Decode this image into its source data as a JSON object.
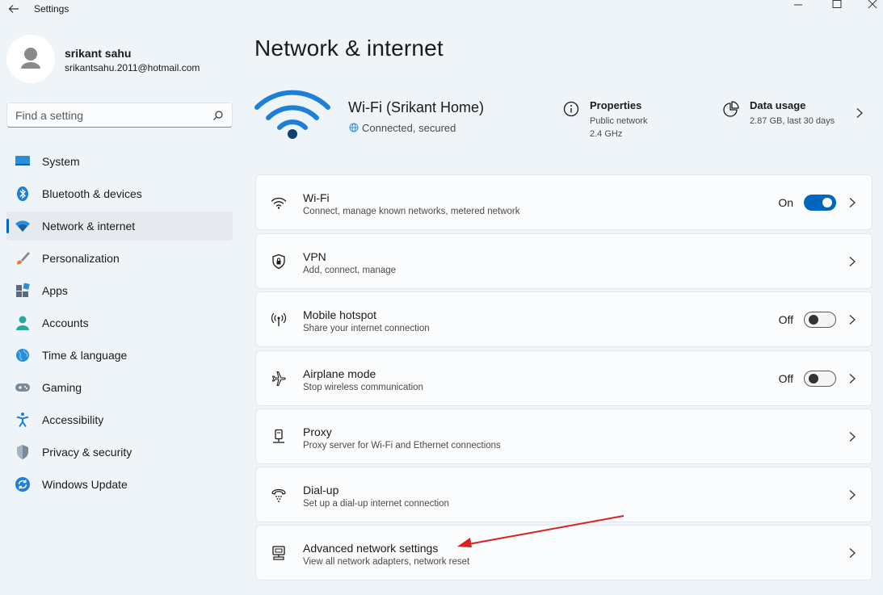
{
  "window": {
    "title": "Settings"
  },
  "user": {
    "name": "srikant sahu",
    "email": "srikantsahu.2011@hotmail.com"
  },
  "search": {
    "placeholder": "Find a setting"
  },
  "sidebar": {
    "items": [
      {
        "label": "System",
        "icon": "system-icon"
      },
      {
        "label": "Bluetooth & devices",
        "icon": "bluetooth-icon"
      },
      {
        "label": "Network & internet",
        "icon": "network-icon",
        "selected": true
      },
      {
        "label": "Personalization",
        "icon": "brush-icon"
      },
      {
        "label": "Apps",
        "icon": "apps-icon"
      },
      {
        "label": "Accounts",
        "icon": "account-icon"
      },
      {
        "label": "Time & language",
        "icon": "globe-icon"
      },
      {
        "label": "Gaming",
        "icon": "gamepad-icon"
      },
      {
        "label": "Accessibility",
        "icon": "accessibility-icon"
      },
      {
        "label": "Privacy & security",
        "icon": "shield-icon"
      },
      {
        "label": "Windows Update",
        "icon": "update-icon"
      }
    ]
  },
  "page": {
    "title": "Network & internet"
  },
  "hero": {
    "network_name": "Wi-Fi (Srikant Home)",
    "status": "Connected, secured",
    "properties": {
      "title": "Properties",
      "line1": "Public network",
      "line2": "2.4 GHz"
    },
    "data_usage": {
      "title": "Data usage",
      "line1": "2.87 GB, last 30 days"
    }
  },
  "cards": [
    {
      "title": "Wi-Fi",
      "subtitle": "Connect, manage known networks, metered network",
      "icon": "wifi-icon",
      "toggle_label": "On",
      "toggle_on": true
    },
    {
      "title": "VPN",
      "subtitle": "Add, connect, manage",
      "icon": "vpn-shield-icon"
    },
    {
      "title": "Mobile hotspot",
      "subtitle": "Share your internet connection",
      "icon": "hotspot-icon",
      "toggle_label": "Off",
      "toggle_on": false
    },
    {
      "title": "Airplane mode",
      "subtitle": "Stop wireless communication",
      "icon": "airplane-icon",
      "toggle_label": "Off",
      "toggle_on": false
    },
    {
      "title": "Proxy",
      "subtitle": "Proxy server for Wi-Fi and Ethernet connections",
      "icon": "proxy-icon"
    },
    {
      "title": "Dial-up",
      "subtitle": "Set up a dial-up internet connection",
      "icon": "dialup-icon"
    },
    {
      "title": "Advanced network settings",
      "subtitle": "View all network adapters, network reset",
      "icon": "advanced-network-icon"
    }
  ],
  "colors": {
    "accent": "#0067c0",
    "background": "#eff4f9",
    "annotation_arrow": "#d9201e"
  }
}
